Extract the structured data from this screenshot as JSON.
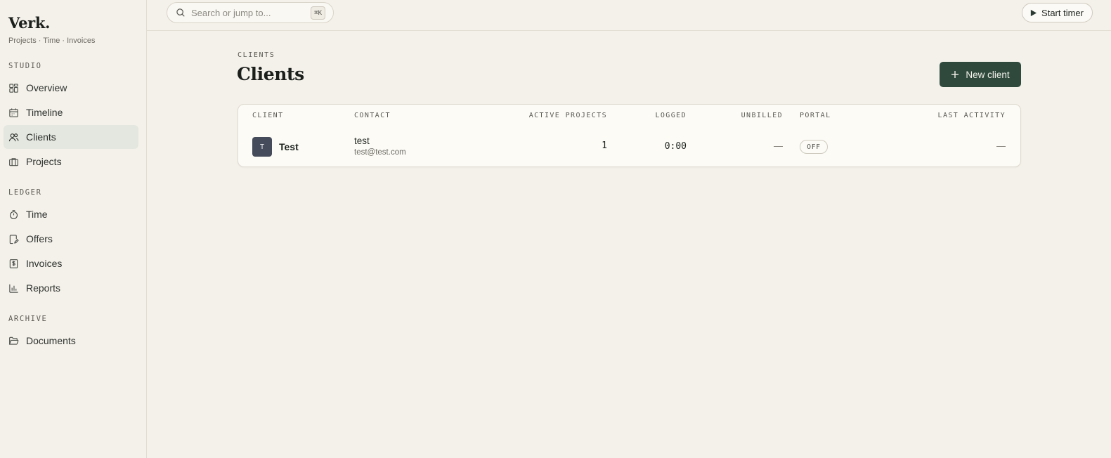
{
  "brand": {
    "name": "Verk.",
    "subtitle": "Projects · Time · Invoices"
  },
  "sidebar": {
    "sections": [
      {
        "label": "STUDIO"
      },
      {
        "label": "LEDGER"
      },
      {
        "label": "ARCHIVE"
      }
    ],
    "items": [
      {
        "label": "Overview",
        "icon": "grid-icon"
      },
      {
        "label": "Timeline",
        "icon": "calendar-icon"
      },
      {
        "label": "Clients",
        "icon": "users-icon",
        "active": true
      },
      {
        "label": "Projects",
        "icon": "briefcase-icon"
      },
      {
        "label": "Time",
        "icon": "stopwatch-icon"
      },
      {
        "label": "Offers",
        "icon": "document-edit-icon"
      },
      {
        "label": "Invoices",
        "icon": "dollar-receipt-icon"
      },
      {
        "label": "Reports",
        "icon": "bar-chart-icon"
      },
      {
        "label": "Documents",
        "icon": "folder-open-icon"
      }
    ]
  },
  "topbar": {
    "search": {
      "placeholder": "Search or jump to...",
      "shortcut": "⌘K"
    },
    "start_timer": "Start timer"
  },
  "main": {
    "eyebrow": "CLIENTS",
    "title": "Clients",
    "new_client": "New client"
  },
  "table": {
    "columns": [
      "CLIENT",
      "CONTACT",
      "ACTIVE PROJECTS",
      "LOGGED",
      "UNBILLED",
      "PORTAL",
      "LAST ACTIVITY"
    ],
    "rows": [
      {
        "initial": "T",
        "client": "Test",
        "contact_name": "test",
        "contact_email": "test@test.com",
        "active_projects": "1",
        "logged": "0:00",
        "unbilled": "—",
        "portal": "OFF",
        "last_activity": "—"
      }
    ]
  },
  "colors": {
    "background": "#f4f1ea",
    "accent": "#2f4a3d",
    "active_nav": "#e4e7df",
    "avatar": "#454b5a"
  }
}
